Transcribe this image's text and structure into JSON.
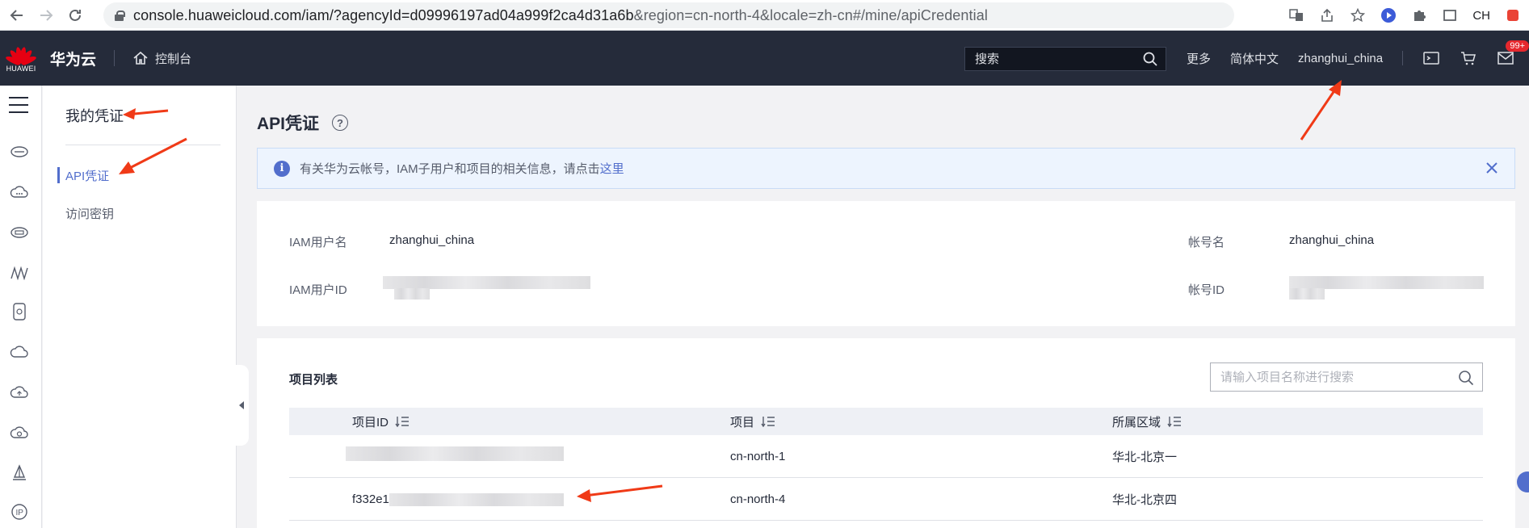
{
  "browser": {
    "url_main": "console.huaweicloud.com/iam/?agencyId=d09996197ad04a999f2ca4d31a6b",
    "url_tail": "&region=cn-north-4&locale=zh-cn#/mine/apiCredential",
    "lang_label": "CH"
  },
  "header": {
    "logo_text": "HUAWEI",
    "brand": "华为云",
    "console": "控制台",
    "search_placeholder": "搜索",
    "more": "更多",
    "language": "简体中文",
    "username": "zhanghui_china",
    "badge": "99+"
  },
  "sidebar": {
    "title": "我的凭证",
    "items": [
      {
        "label": "API凭证",
        "active": true
      },
      {
        "label": "访问密钥",
        "active": false
      }
    ]
  },
  "page": {
    "title": "API凭证",
    "info_text": "有关华为云帐号，IAM子用户和项目的相关信息，请点击",
    "info_link": "这里"
  },
  "credentials": {
    "iam_user_label": "IAM用户名",
    "iam_user_value": "zhanghui_china",
    "account_label": "帐号名",
    "account_value": "zhanghui_china",
    "iam_id_label": "IAM用户ID",
    "account_id_label": "帐号ID"
  },
  "projects": {
    "title": "项目列表",
    "search_placeholder": "请输入项目名称进行搜索",
    "columns": [
      "项目ID",
      "项目",
      "所属区域"
    ],
    "rows": [
      {
        "id_prefix": "",
        "project": "cn-north-1",
        "region": "华北-北京一"
      },
      {
        "id_prefix": "f332e1",
        "project": "cn-north-4",
        "region": "华北-北京四"
      }
    ]
  },
  "colors": {
    "topbar": "#252b3a",
    "accent": "#526ecc",
    "annotation_red": "#f03a17"
  }
}
